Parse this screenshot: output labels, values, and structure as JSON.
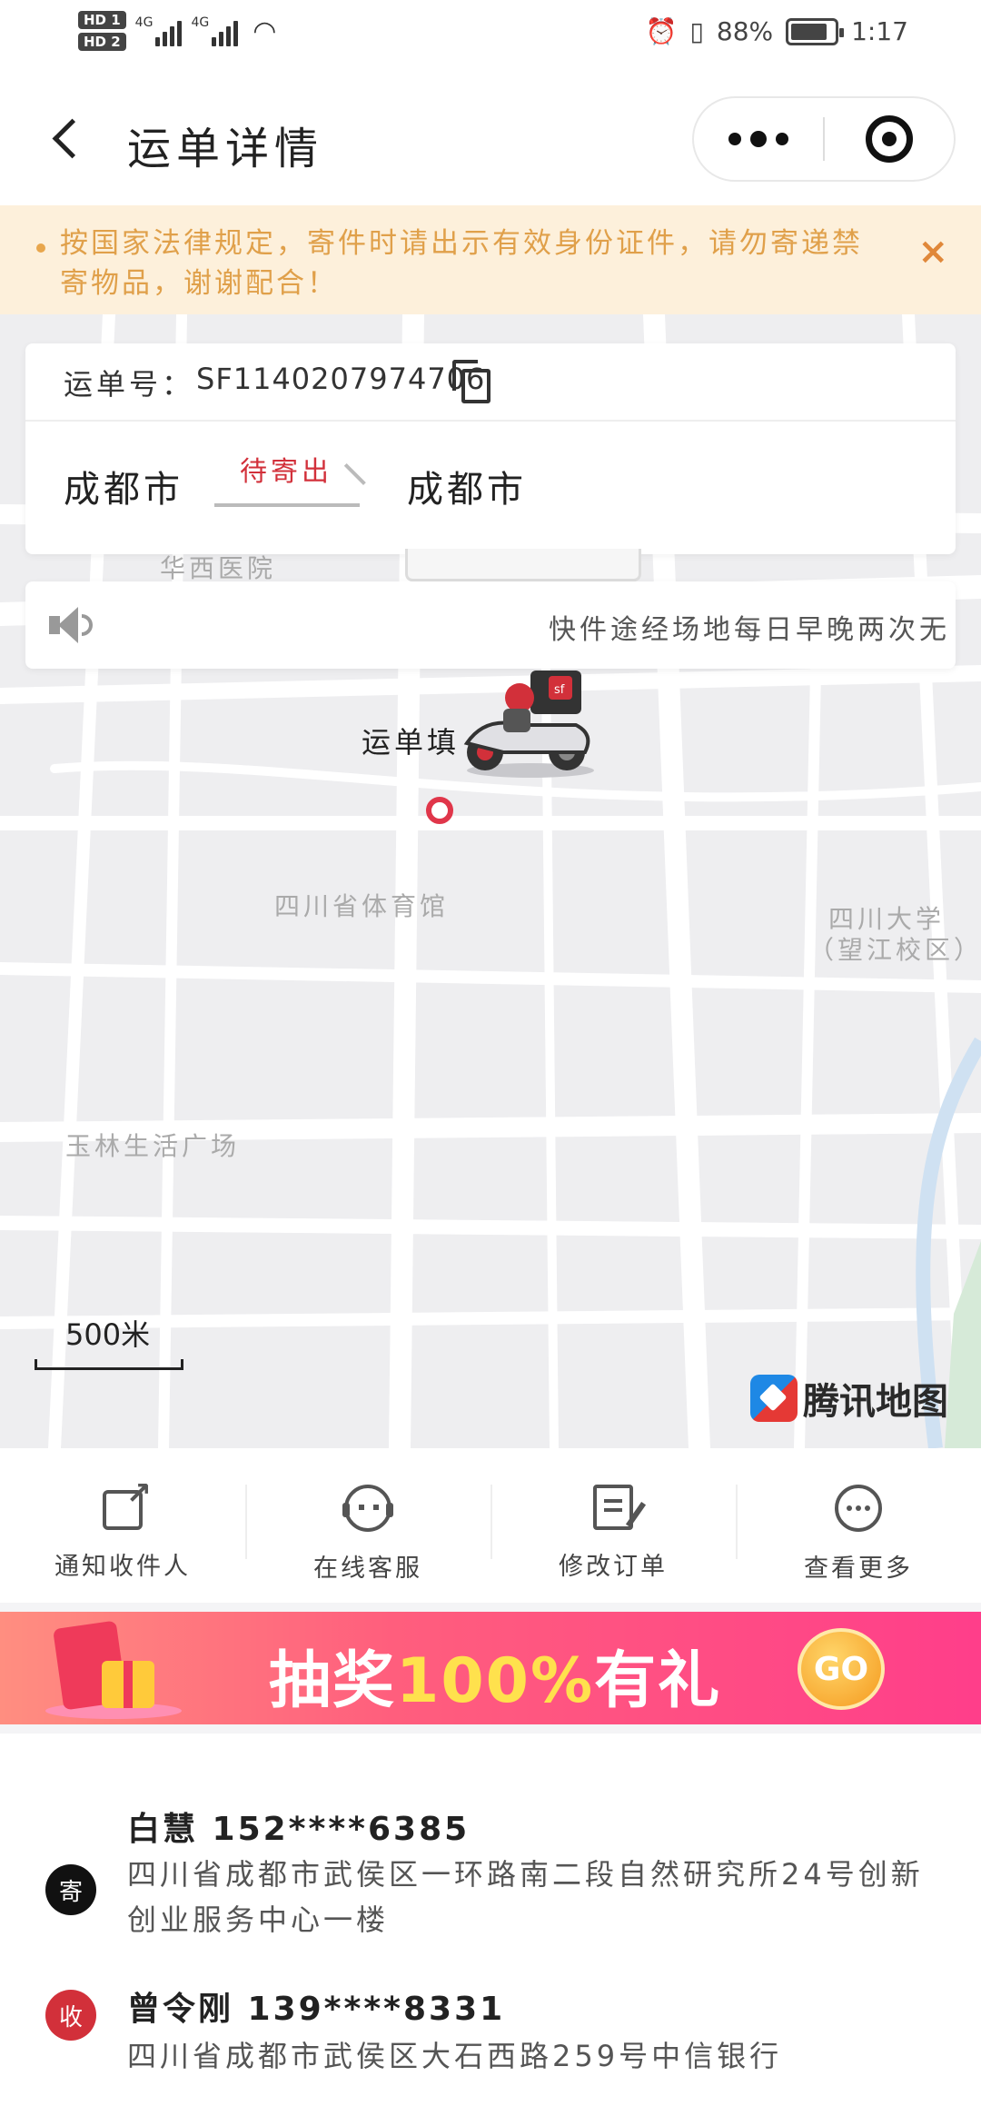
{
  "status_bar": {
    "hd1": "HD 1",
    "hd2": "HD 2",
    "net1": "4G",
    "net2": "4G",
    "battery": "88%",
    "time": "1:17"
  },
  "header": {
    "title": "运单详情"
  },
  "notice": {
    "text": "按国家法律规定，寄件时请出示有效身份证件，请勿寄递禁寄物品，谢谢配合！",
    "close": "×"
  },
  "waybill": {
    "label": "运单号：",
    "number": "SF1140207974706",
    "from_city": "成都市",
    "to_city": "成都市",
    "status": "待寄出"
  },
  "announcement": {
    "text": "快件途经场地每日早晚两次无"
  },
  "map": {
    "labels": {
      "huaxi": "华西医院",
      "stadium": "四川省体育馆",
      "scu_line1": "四川大学",
      "scu_line2": "（望江校区）",
      "yulin": "玉林生活广场"
    },
    "bubble": "运单填",
    "scale": "500米",
    "provider": "腾讯地图"
  },
  "actions": [
    {
      "label": "通知收件人",
      "icon": "share-icon"
    },
    {
      "label": "在线客服",
      "icon": "customer-service-icon"
    },
    {
      "label": "修改订单",
      "icon": "edit-order-icon"
    },
    {
      "label": "查看更多",
      "icon": "more-icon"
    }
  ],
  "promo": {
    "prefix": "抽奖",
    "number": "100%",
    "suffix": "有礼",
    "go": "GO"
  },
  "sender": {
    "badge": "寄",
    "name": "白慧 152****6385",
    "address": "四川省成都市武侯区一环路南二段自然研究所24号创新创业服务中心一楼"
  },
  "receiver": {
    "badge": "收",
    "name": "曾令刚 139****8331",
    "address": "四川省成都市武侯区大石西路259号中信银行"
  },
  "colors": {
    "accent_red": "#d2303a",
    "notice_bg": "#fdf0db",
    "notice_text": "#e0a04a"
  }
}
